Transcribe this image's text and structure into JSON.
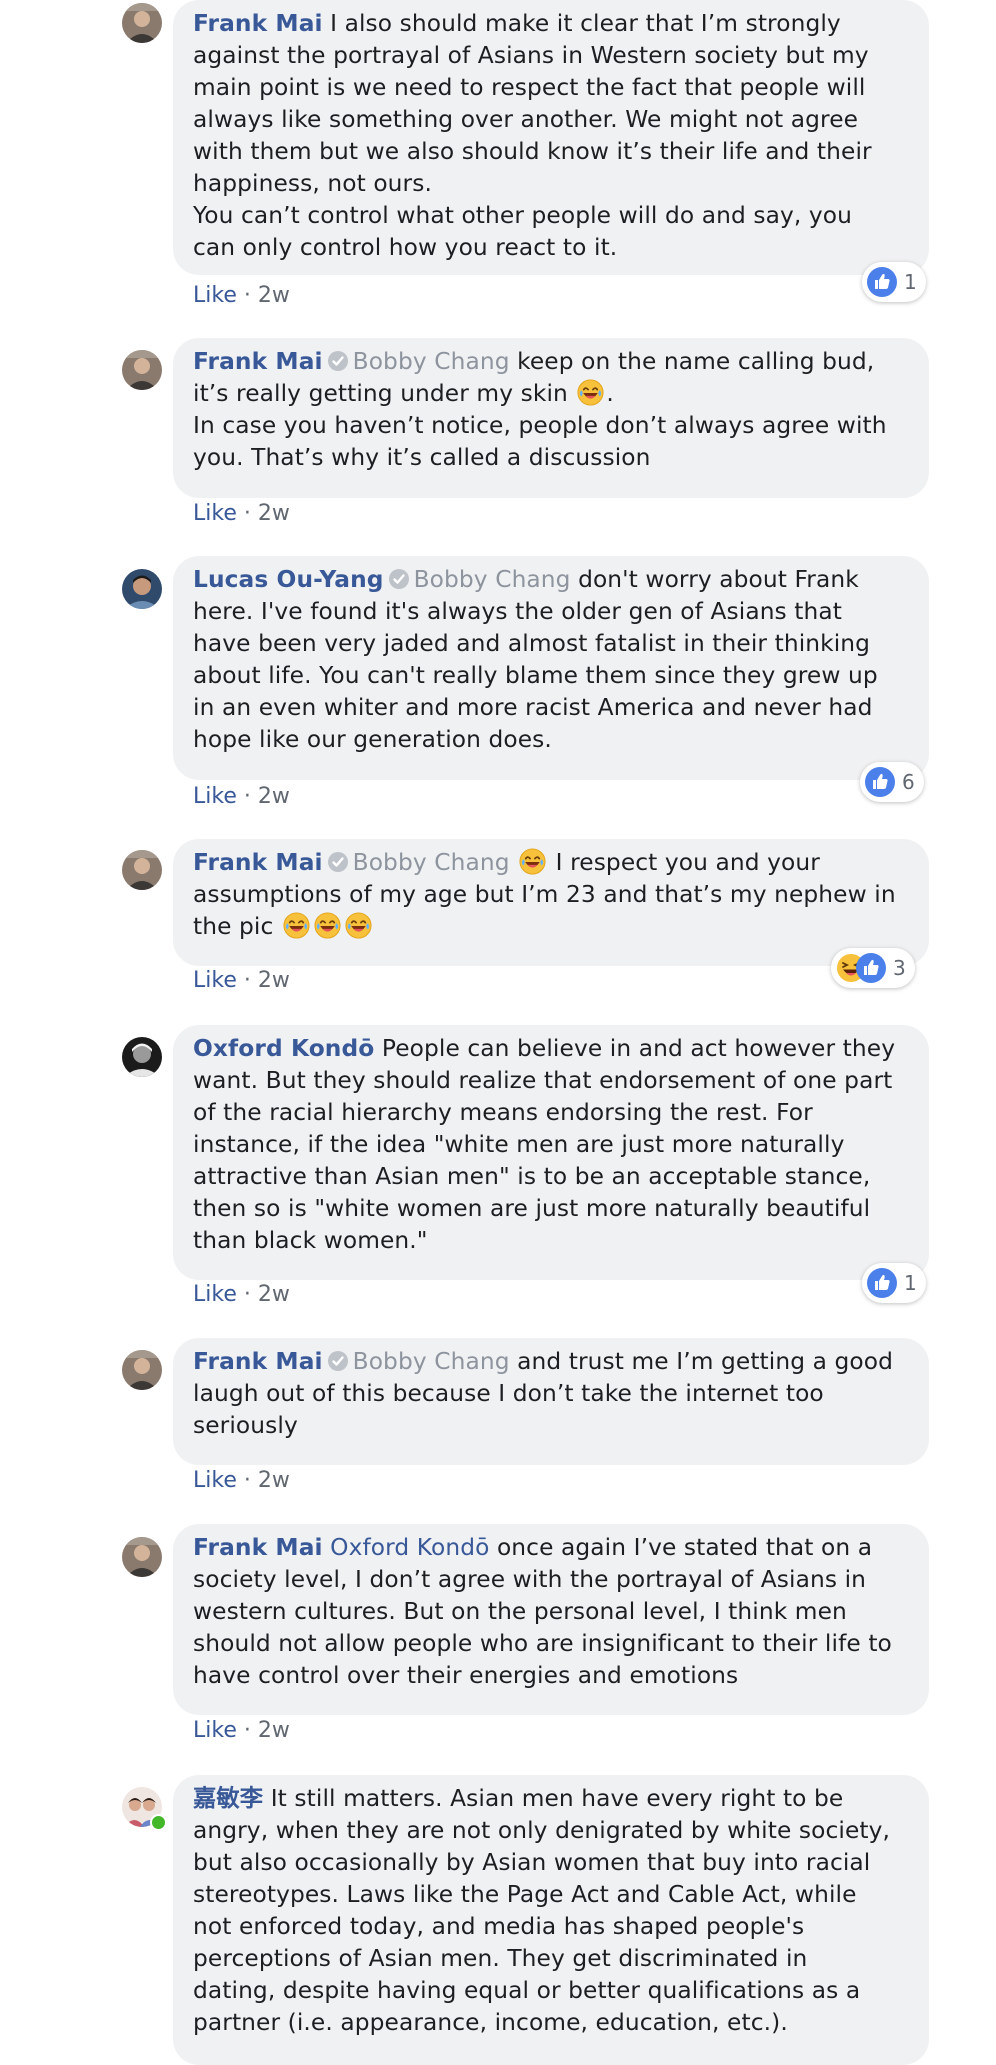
{
  "comments": [
    {
      "author": "Frank Mai",
      "line1": " I also should make it clear that I’m strongly",
      "line2": "against the portrayal of Asians in Western society but my",
      "line3": "main point is we need to respect the fact that people will",
      "line4": "always like something over another. We might not agree",
      "line5": "with them but we also should know it’s their life and their",
      "line6": "happiness, not ours.",
      "line7": "You can’t control what other people will do and say, you",
      "line8": "can only control how you react to it.",
      "like": "Like",
      "sep": " · ",
      "time": "2w",
      "reaction_count": "1"
    },
    {
      "author": "Frank Mai",
      "tag": "Bobby Chang",
      "line1": " keep on the name calling bud,",
      "line2": "it’s really getting under my skin",
      "line2b": ".",
      "line3": "In case you haven’t notice, people don’t always agree with",
      "line4": "you. That’s why it’s called a discussion",
      "like": "Like",
      "sep": " · ",
      "time": "2w"
    },
    {
      "author": "Lucas Ou-Yang",
      "tag": "Bobby Chang",
      "line1": " don't worry about Frank",
      "line2": "here. I've found it's always the older gen of Asians that",
      "line3": "have been very jaded and almost fatalist in their thinking",
      "line4": "about life. You can't really blame them since they grew up",
      "line5": "in an even whiter and more racist America and never had",
      "line6": "hope like our generation does.",
      "like": "Like",
      "sep": " · ",
      "time": "2w",
      "reaction_count": "6"
    },
    {
      "author": "Frank Mai",
      "tag": "Bobby Chang",
      "line1": " I respect you and your",
      "line2": "assumptions of my age but I’m 23 and that’s my nephew in",
      "line3": "the pic",
      "like": "Like",
      "sep": " · ",
      "time": "2w",
      "reaction_count": "3"
    },
    {
      "author": "Oxford Kondō",
      "line1": " People can believe in and act however they",
      "line2": "want. But they should realize that endorsement of one part",
      "line3": "of the racial hierarchy means endorsing the rest. For",
      "line4": "instance, if the idea \"white men are just more naturally",
      "line5": "attractive than Asian men\" is to be an acceptable stance,",
      "line6": "then so is \"white women are just more naturally beautiful",
      "line7": "than black women.\"",
      "like": "Like",
      "sep": " · ",
      "time": "2w",
      "reaction_count": "1"
    },
    {
      "author": "Frank Mai",
      "tag": "Bobby Chang",
      "line1": " and trust me I’m getting a good",
      "line2": "laugh out of this because I don’t take the internet too",
      "line3": "seriously",
      "like": "Like",
      "sep": " · ",
      "time": "2w"
    },
    {
      "author": "Frank Mai",
      "tag": " Oxford Kondō",
      "line1": " once again I’ve stated that on a",
      "line2": "society level, I don’t agree with the portrayal of Asians in",
      "line3": "western cultures. But on the personal level, I think men",
      "line4": "should not allow people who are insignificant to their life to",
      "line5": "have control over their energies and emotions",
      "like": "Like",
      "sep": " · ",
      "time": "2w"
    },
    {
      "author": "嘉敏李",
      "line1": " It still matters. Asian men have every right to be",
      "line2": "angry, when they are not only denigrated by white society,",
      "line3": "but also occasionally by Asian women that buy into racial",
      "line4": "stereotypes. Laws like the Page Act and Cable Act, while",
      "line5": "not enforced today, and media has shaped people's",
      "line6": "perceptions of Asian men. They get discriminated in",
      "line7": "dating, despite having equal or better qualifications as a",
      "line8": "partner (i.e. appearance, income, education, etc.)."
    }
  ],
  "colors": {
    "link": "#385898",
    "bubble": "#f0f1f3",
    "meta": "#606770",
    "tag": "#8d949e",
    "like_blue": "#4080ff",
    "online": "#42b72a"
  },
  "icons": [
    "avatar",
    "verified-icon",
    "laughing-emoji",
    "like-reaction-icon",
    "haha-reaction-icon"
  ]
}
